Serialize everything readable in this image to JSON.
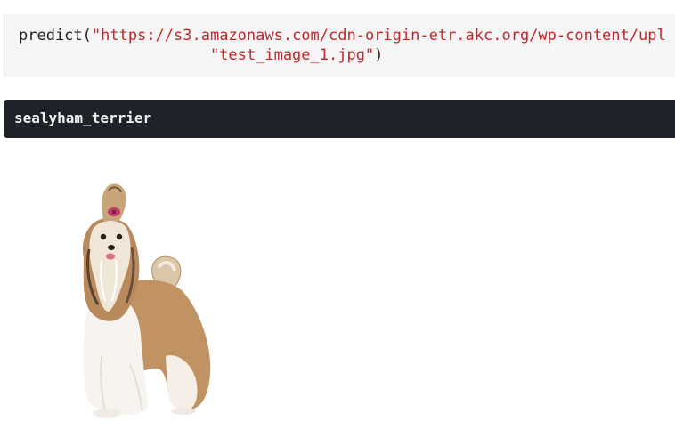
{
  "code_cell": {
    "function_name": "predict",
    "open_paren": "(",
    "url_string": "\"https://s3.amazonaws.com/cdn-origin-etr.akc.org/wp-content/upl",
    "indent": "                     ",
    "filename_string": "\"test_image_1.jpg\"",
    "close_paren": ")"
  },
  "output": {
    "text": "sealyham_terrier"
  },
  "image": {
    "subject": "shih-tzu-dog-photo"
  }
}
